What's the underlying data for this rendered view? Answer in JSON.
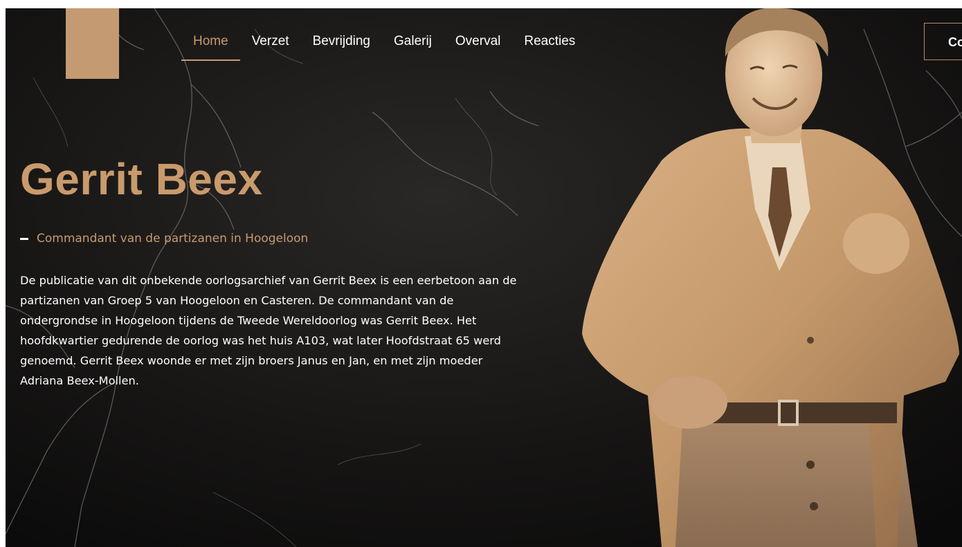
{
  "nav": {
    "items": [
      {
        "label": "Home",
        "active": true
      },
      {
        "label": "Verzet",
        "active": false
      },
      {
        "label": "Bevrijding",
        "active": false
      },
      {
        "label": "Galerij",
        "active": false
      },
      {
        "label": "Overval",
        "active": false
      },
      {
        "label": "Reacties",
        "active": false
      }
    ]
  },
  "header": {
    "contact_label": "Co"
  },
  "hero": {
    "title": "Gerrit Beex",
    "subtitle": "Commandant van de partizanen in Hoogeloon",
    "intro": "De publicatie van dit onbekende oorlogsarchief van Gerrit Beex is een eerbetoon aan de partizanen van Groep 5 van Hoogeloon en Casteren. De commandant van de ondergrondse in Hoogeloon tijdens de Tweede Wereldoorlog was Gerrit Beex. Het hoofdkwartier gedurende de oorlog was het huis A103, wat later Hoofdstraat 65 werd genoemd. Gerrit Beex woonde er met zijn broers Janus en Jan, en met zijn moeder Adriana Beex-Mollen."
  },
  "colors": {
    "accent": "#c99a6c",
    "logo": "#c49a72",
    "background": "#0f0e0d",
    "text": "#ffffff"
  }
}
